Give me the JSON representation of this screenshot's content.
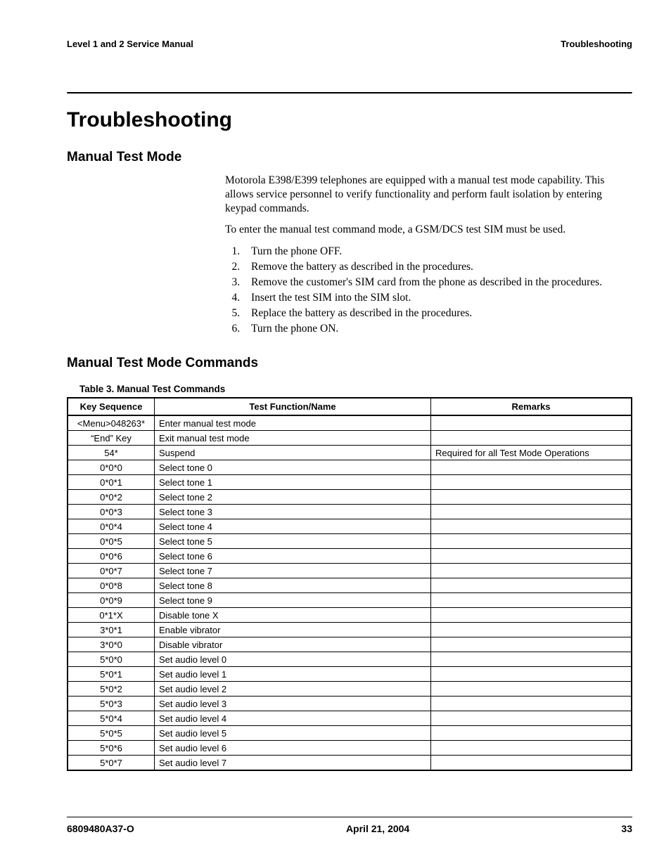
{
  "header": {
    "left": "Level 1 and 2 Service Manual",
    "right": "Troubleshooting"
  },
  "chapter_title": "Troubleshooting",
  "section1": {
    "heading": "Manual Test Mode",
    "para1": "Motorola E398/E399 telephones are equipped with a manual test mode capability. This allows service personnel to verify functionality and perform fault isolation by entering keypad commands.",
    "para2": "To enter the manual test command mode, a GSM/DCS test SIM must be used.",
    "steps": [
      "Turn the phone OFF.",
      "Remove the battery as described in the procedures.",
      "Remove the customer's SIM card from the phone as described in the procedures.",
      "Insert the test SIM into the SIM slot.",
      "Replace the battery as described in the procedures.",
      "Turn the phone ON."
    ]
  },
  "section2": {
    "heading": "Manual Test Mode Commands",
    "table_caption": "Table 3. Manual Test Commands",
    "columns": [
      "Key Sequence",
      "Test Function/Name",
      "Remarks"
    ],
    "rows": [
      {
        "key": "<Menu>048263*",
        "func": "Enter manual test mode",
        "rem": ""
      },
      {
        "key": "“End” Key",
        "func": "Exit manual test mode",
        "rem": ""
      },
      {
        "key": "54*",
        "func": "Suspend",
        "rem": "Required for all Test Mode Operations"
      },
      {
        "key": "0*0*0",
        "func": "Select tone 0",
        "rem": ""
      },
      {
        "key": "0*0*1",
        "func": "Select tone 1",
        "rem": ""
      },
      {
        "key": "0*0*2",
        "func": "Select tone 2",
        "rem": ""
      },
      {
        "key": "0*0*3",
        "func": "Select tone 3",
        "rem": ""
      },
      {
        "key": "0*0*4",
        "func": "Select tone 4",
        "rem": ""
      },
      {
        "key": "0*0*5",
        "func": "Select tone 5",
        "rem": ""
      },
      {
        "key": "0*0*6",
        "func": "Select tone 6",
        "rem": ""
      },
      {
        "key": "0*0*7",
        "func": "Select tone 7",
        "rem": ""
      },
      {
        "key": "0*0*8",
        "func": "Select tone 8",
        "rem": ""
      },
      {
        "key": "0*0*9",
        "func": "Select tone 9",
        "rem": ""
      },
      {
        "key": "0*1*X",
        "func": "Disable tone X",
        "rem": ""
      },
      {
        "key": "3*0*1",
        "func": "Enable vibrator",
        "rem": ""
      },
      {
        "key": "3*0*0",
        "func": "Disable vibrator",
        "rem": ""
      },
      {
        "key": "5*0*0",
        "func": "Set audio level 0",
        "rem": ""
      },
      {
        "key": "5*0*1",
        "func": "Set audio level 1",
        "rem": ""
      },
      {
        "key": "5*0*2",
        "func": "Set audio level 2",
        "rem": ""
      },
      {
        "key": "5*0*3",
        "func": "Set audio level 3",
        "rem": ""
      },
      {
        "key": "5*0*4",
        "func": "Set audio level 4",
        "rem": ""
      },
      {
        "key": "5*0*5",
        "func": "Set audio level 5",
        "rem": ""
      },
      {
        "key": "5*0*6",
        "func": "Set audio level 6",
        "rem": ""
      },
      {
        "key": "5*0*7",
        "func": "Set audio level 7",
        "rem": ""
      }
    ]
  },
  "footer": {
    "left": "6809480A37-O",
    "center": "April 21, 2004",
    "right": "33"
  }
}
